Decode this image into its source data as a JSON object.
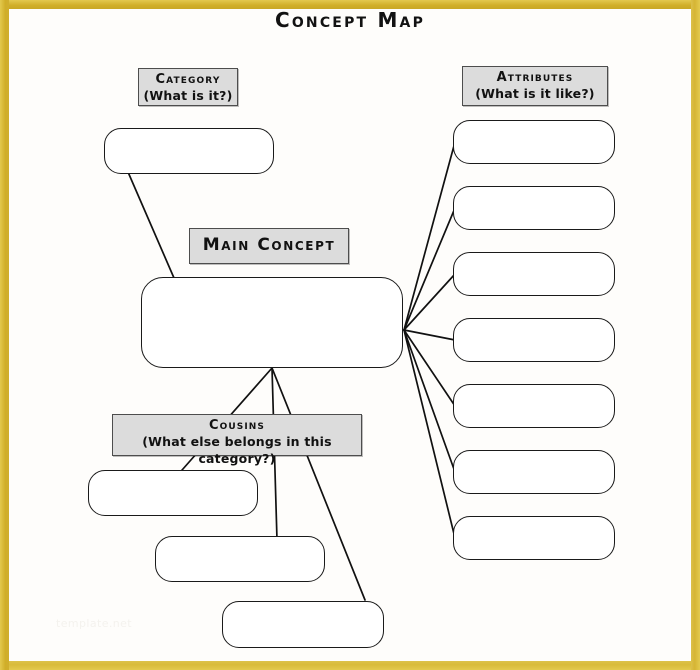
{
  "page": {
    "title": "Concept Map",
    "frame_color": "#d9bb3a",
    "background_color": "#fefdfb",
    "watermark": "template.net"
  },
  "labels": {
    "category": {
      "title": "Category",
      "subtitle": "(What is it?)"
    },
    "attributes": {
      "title": "Attributes",
      "subtitle": "(What is it like?)"
    },
    "main_concept": {
      "title": "Main Concept"
    },
    "cousins": {
      "title": "Cousins",
      "subtitle": "(What else belongs in this category?)"
    }
  },
  "nodes": {
    "category_boxes": [
      {
        "name": "category-box-1",
        "value": ""
      }
    ],
    "main_concept_box": {
      "name": "main-concept-box",
      "value": ""
    },
    "attribute_boxes": [
      {
        "name": "attribute-box-1",
        "value": ""
      },
      {
        "name": "attribute-box-2",
        "value": ""
      },
      {
        "name": "attribute-box-3",
        "value": ""
      },
      {
        "name": "attribute-box-4",
        "value": ""
      },
      {
        "name": "attribute-box-5",
        "value": ""
      },
      {
        "name": "attribute-box-6",
        "value": ""
      },
      {
        "name": "attribute-box-7",
        "value": ""
      }
    ],
    "cousin_boxes": [
      {
        "name": "cousin-box-1",
        "value": ""
      },
      {
        "name": "cousin-box-2",
        "value": ""
      },
      {
        "name": "cousin-box-3",
        "value": ""
      }
    ]
  },
  "counts": {
    "attribute_boxes": 7,
    "cousin_boxes": 3,
    "category_boxes": 1
  }
}
